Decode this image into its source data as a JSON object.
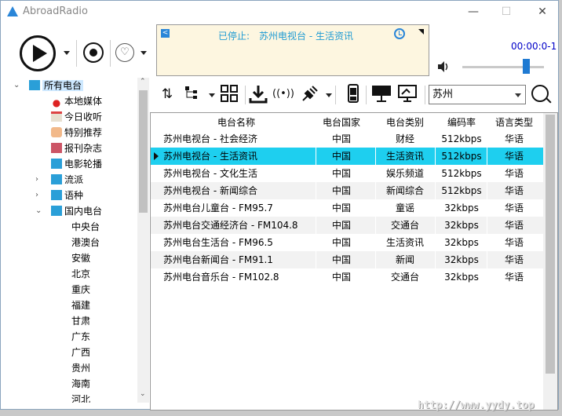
{
  "app": {
    "title": "AbroadRadio",
    "minimize": "—",
    "maximize": "☐",
    "close": "✕"
  },
  "status": {
    "label": "已停止:",
    "station": "苏州电视台 - 生活资讯"
  },
  "time": "00:00:0-1",
  "tree": {
    "root": "所有电台",
    "items": [
      "本地媒体",
      "今日收听",
      "特别推荐",
      "报刊杂志",
      "电影轮播",
      "流派",
      "语种",
      "国内电台"
    ],
    "provinces": [
      "中央台",
      "港澳台",
      "安徽",
      "北京",
      "重庆",
      "福建",
      "甘肃",
      "广东",
      "广西",
      "贵州",
      "海南",
      "河北"
    ]
  },
  "filter": {
    "province": "苏州"
  },
  "table": {
    "headers": [
      "电台名称",
      "电台国家",
      "电台类别",
      "编码率",
      "语言类型"
    ],
    "rows": [
      [
        "苏州电视台 - 社会经济",
        "中国",
        "财经",
        "512kbps",
        "华语"
      ],
      [
        "苏州电视台 - 生活资讯",
        "中国",
        "生活资讯",
        "512kbps",
        "华语"
      ],
      [
        "苏州电视台 - 文化生活",
        "中国",
        "娱乐频道",
        "512kbps",
        "华语"
      ],
      [
        "苏州电视台 - 新闻综合",
        "中国",
        "新闻综合",
        "512kbps",
        "华语"
      ],
      [
        "苏州电台儿童台 - FM95.7",
        "中国",
        "童谣",
        "32kbps",
        "华语"
      ],
      [
        "苏州电台交通经济台 - FM104.8",
        "中国",
        "交通台",
        "32kbps",
        "华语"
      ],
      [
        "苏州电台生活台 - FM96.5",
        "中国",
        "生活资讯",
        "32kbps",
        "华语"
      ],
      [
        "苏州电台新闻台 - FM91.1",
        "中国",
        "新闻",
        "32kbps",
        "华语"
      ],
      [
        "苏州电台音乐台 - FM102.8",
        "中国",
        "交通台",
        "32kbps",
        "华语"
      ]
    ],
    "selected_row": 1
  },
  "volume": {
    "level": 0.78
  },
  "watermark": "http://www.yydy.top",
  "colors": {
    "selection": "#1ecfef",
    "accent": "#1f7ad2",
    "status_text": "#1f9bd3",
    "time_text": "#0000c8"
  }
}
